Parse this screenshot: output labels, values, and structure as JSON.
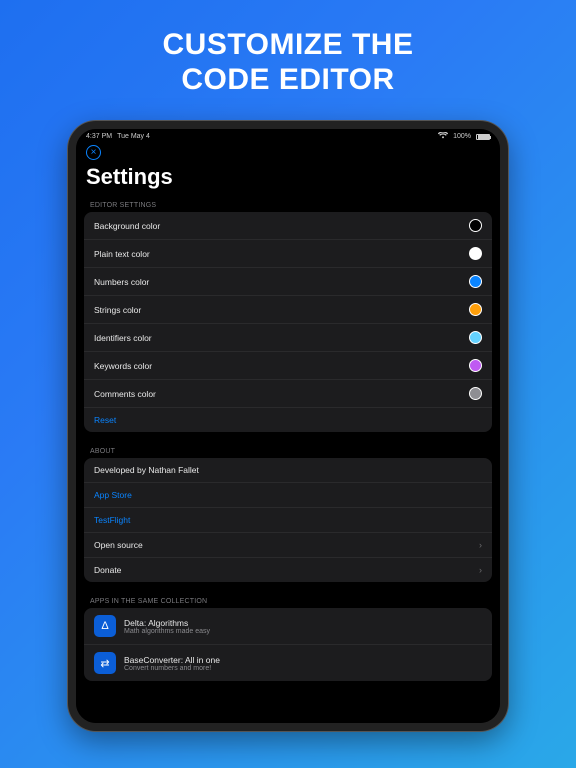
{
  "promo": {
    "line1": "CUSTOMIZE THE",
    "line2": "CODE EDITOR"
  },
  "status": {
    "time": "4:37 PM",
    "date": "Tue May 4",
    "battery": "100%"
  },
  "closeGlyph": "×",
  "title": "Settings",
  "sections": {
    "editor": {
      "header": "EDITOR SETTINGS",
      "rows": [
        {
          "label": "Background color",
          "color": "#000000"
        },
        {
          "label": "Plain text color",
          "color": "#ffffff"
        },
        {
          "label": "Numbers color",
          "color": "#0a84ff"
        },
        {
          "label": "Strings color",
          "color": "#ff9f0a"
        },
        {
          "label": "Identifiers color",
          "color": "#64d2ff"
        },
        {
          "label": "Keywords color",
          "color": "#bf5af2"
        },
        {
          "label": "Comments color",
          "color": "#8e8e93"
        }
      ],
      "reset": "Reset"
    },
    "about": {
      "header": "ABOUT",
      "developed": "Developed by Nathan Fallet",
      "appstore": "App Store",
      "testflight": "TestFlight",
      "opensource": "Open source",
      "donate": "Donate"
    },
    "apps": {
      "header": "APPS IN THE SAME COLLECTION",
      "items": [
        {
          "name": "Delta: Algorithms",
          "sub": "Math algorithms made easy",
          "glyph": "Δ"
        },
        {
          "name": "BaseConverter: All in one",
          "sub": "Convert numbers and more!",
          "glyph": "⇄"
        }
      ]
    }
  }
}
